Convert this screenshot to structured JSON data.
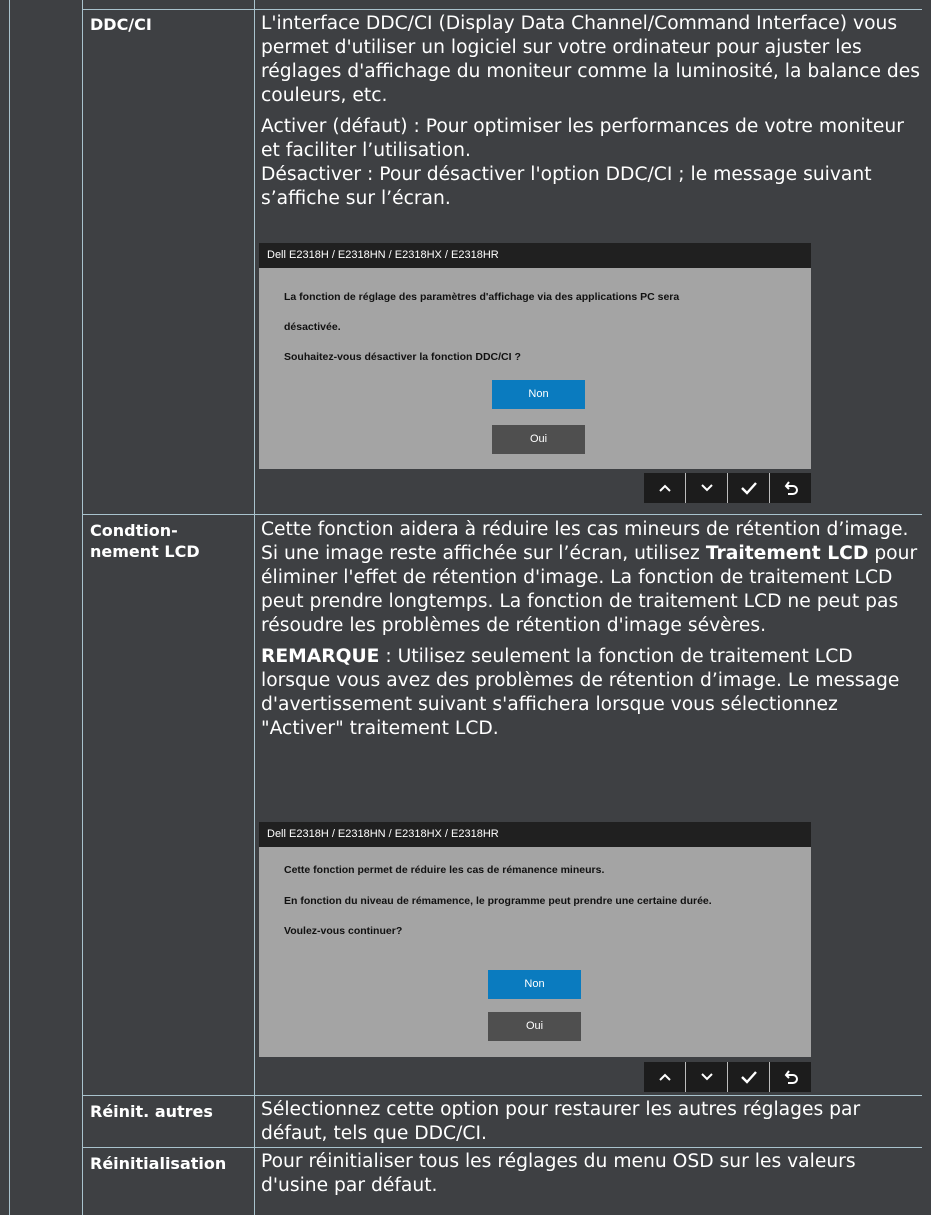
{
  "rows": [
    {
      "label": "DDC/CI",
      "paragraphs": [
        "L'interface DDC/CI (Display Data Channel/Command Interface) vous permet d'utiliser un logiciel sur votre ordinateur pour ajuster les réglages d'affichage du moniteur comme la luminosité, la balance des couleurs, etc.",
        "Activer (défaut) : Pour optimiser les performances de votre moniteur et faciliter l’utilisation.",
        "Désactiver : Pour désactiver l'option DDC/CI ; le message suivant s’affiche sur l’écran."
      ],
      "dialog": {
        "title": "Dell  E2318H / E2318HN / E2318HX / E2318HR",
        "lines": [
          "La fonction de réglage des paramètres d'affichage via des applications PC sera",
          "désactivée.",
          "Souhaitez-vous désactiver la fonction DDC/CI ?"
        ],
        "btn_non": "Non",
        "btn_oui": "Oui"
      }
    },
    {
      "label_line1": "Condtion-",
      "label_line2": "nement LCD",
      "p1": "Cette fonction aidera à réduire les cas mineurs de rétention d’image.",
      "p2_before": "Si une image reste affichée sur l’écran, utilisez ",
      "p2_bold": "Traitement LCD",
      "p2_after": " pour éliminer l'effet de rétention d'image. La fonction de traitement LCD peut prendre longtemps. La fonction de traitement LCD ne peut pas résoudre les problèmes de rétention d'image sévères.",
      "note_bold": "REMARQUE",
      "note_text": " : Utilisez seulement la fonction de traitement LCD lorsque vous avez des problèmes de rétention d’image. Le message d'avertissement suivant s'affichera lorsque vous sélectionnez \"Activer\" traitement LCD.",
      "dialog": {
        "title": "Dell  E2318H / E2318HN / E2318HX / E2318HR",
        "lines": [
          "Cette fonction permet de réduire les cas de rémanence mineurs.",
          "En fonction du niveau de rémamence, le programme peut prendre une certaine durée.",
          "Voulez-vous continuer?"
        ],
        "btn_non": "Non",
        "btn_oui": "Oui"
      }
    },
    {
      "label": "Réinit. autres",
      "text": "Sélectionnez cette option pour restaurer les autres réglages par défaut, tels que DDC/CI."
    },
    {
      "label": "Réinitialisation",
      "text": "Pour réinitialiser tous les réglages du menu OSD sur les valeurs d'usine par défaut."
    }
  ],
  "nav_icons": [
    "chevron-up-icon",
    "chevron-down-icon",
    "checkmark-icon",
    "return-icon"
  ],
  "colors": {
    "background": "#3e4043",
    "rule": "#a9c3cd",
    "button_non": "#0a7bbf",
    "button_oui": "#4f4f4f"
  }
}
